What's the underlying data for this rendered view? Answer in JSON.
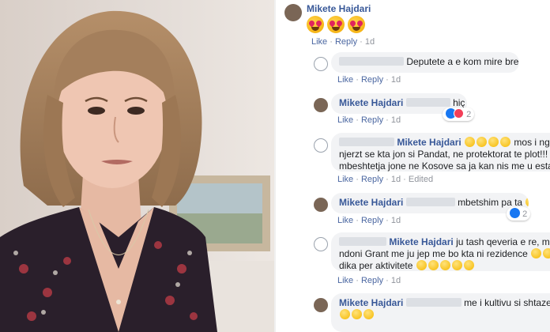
{
  "photo": {
    "description_hidden": ""
  },
  "post": {
    "author": "Mikete Hajdari",
    "like_label": "Like",
    "reply_label": "Reply",
    "time": "1d"
  },
  "comments": [
    {
      "author_visible": "",
      "text": "Deputete a e kom mire bre????",
      "like_label": "Like",
      "reply_label": "Reply",
      "time": "1d"
    },
    {
      "author_visible": "Mikete Hajdari",
      "text": "hiç",
      "reaction_count": "2",
      "like_label": "Like",
      "reply_label": "Reply",
      "time": "1d"
    },
    {
      "mention": "Mikete Hajdari",
      "line1": "mos i ngucni",
      "line2": "njerzt se kta jon si Pandat, ne protektorat te plot!!! Ju duh",
      "line3": "mbeshtetja jone ne Kosove sa ja kan nis me u establishu",
      "like_label": "Like",
      "reply_label": "Reply",
      "time": "1d",
      "edited_label": "Edited"
    },
    {
      "author_visible": "Mikete Hajdari",
      "text": "mbetshim pa ta",
      "reaction_count": "2",
      "like_label": "Like",
      "reply_label": "Reply",
      "time": "1d"
    },
    {
      "mention": "Mikete Hajdari",
      "line1": "ju tash qeveria e re, me m",
      "line2": "ndoni Grant me ju jep me bo kta ni rezidence",
      "line2b": "te",
      "line3": "dika per aktivitete",
      "like_label": "Like",
      "reply_label": "Reply",
      "time": "1d"
    },
    {
      "author_visible": "Mikete Hajdari",
      "text": "me i kultivu si shtazet shte"
    }
  ],
  "colors": {
    "link": "#385898",
    "meta": "#90949c",
    "bubble": "#f2f3f5"
  }
}
